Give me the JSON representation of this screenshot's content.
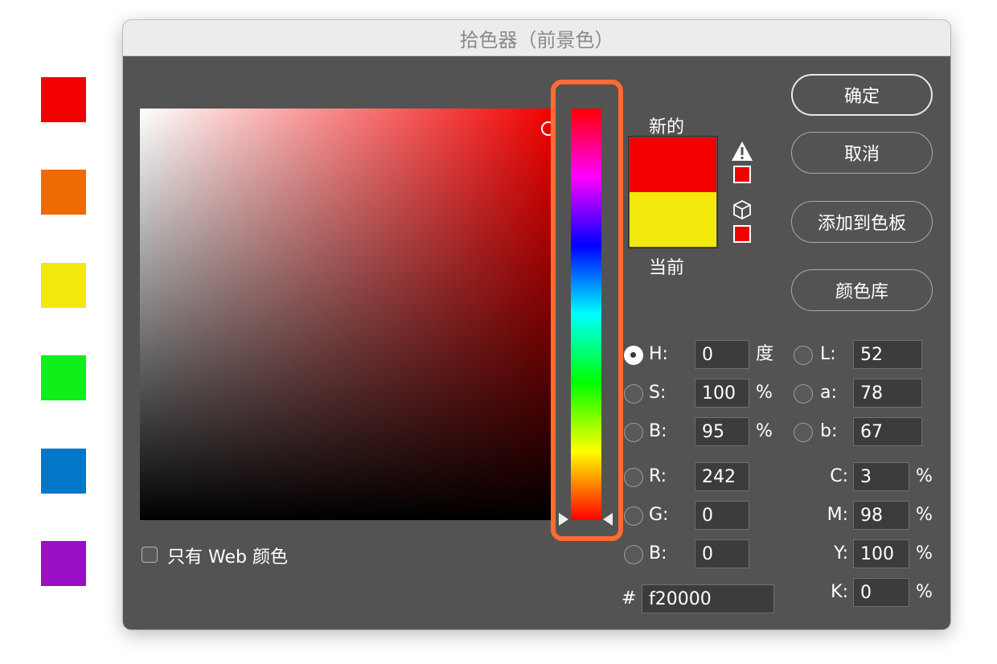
{
  "side_swatches": [
    "#f20000",
    "#ed6a04",
    "#f3e80b",
    "#0ff01a",
    "#0377c9",
    "#9b0fc4"
  ],
  "dialog": {
    "title": "拾色器（前景色）",
    "new_label": "新的",
    "current_label": "当前",
    "new_color": "#f20000",
    "current_color": "#f3e80b",
    "warning_icon": "gamut-warning-icon",
    "web_icon": "web-safe-cube-icon",
    "buttons": {
      "ok": "确定",
      "cancel": "取消",
      "add_to_swatches": "添加到色板",
      "color_libraries": "颜色库"
    },
    "fields": {
      "h": {
        "label": "H:",
        "value": "0",
        "unit": "度"
      },
      "s": {
        "label": "S:",
        "value": "100",
        "unit": "%"
      },
      "br": {
        "label": "B:",
        "value": "95",
        "unit": "%"
      },
      "r": {
        "label": "R:",
        "value": "242"
      },
      "g": {
        "label": "G:",
        "value": "0"
      },
      "bl": {
        "label": "B:",
        "value": "0"
      },
      "l": {
        "label": "L:",
        "value": "52"
      },
      "a": {
        "label": "a:",
        "value": "78"
      },
      "lab_b": {
        "label": "b:",
        "value": "67"
      },
      "c": {
        "label": "C:",
        "value": "3",
        "unit": "%"
      },
      "m": {
        "label": "M:",
        "value": "98",
        "unit": "%"
      },
      "y": {
        "label": "Y:",
        "value": "100",
        "unit": "%"
      },
      "k": {
        "label": "K:",
        "value": "0",
        "unit": "%"
      }
    },
    "hex": {
      "label": "#",
      "value": "f20000"
    },
    "web_only_label": "只有 Web 颜色",
    "highlight_color": "#ff6b35"
  }
}
